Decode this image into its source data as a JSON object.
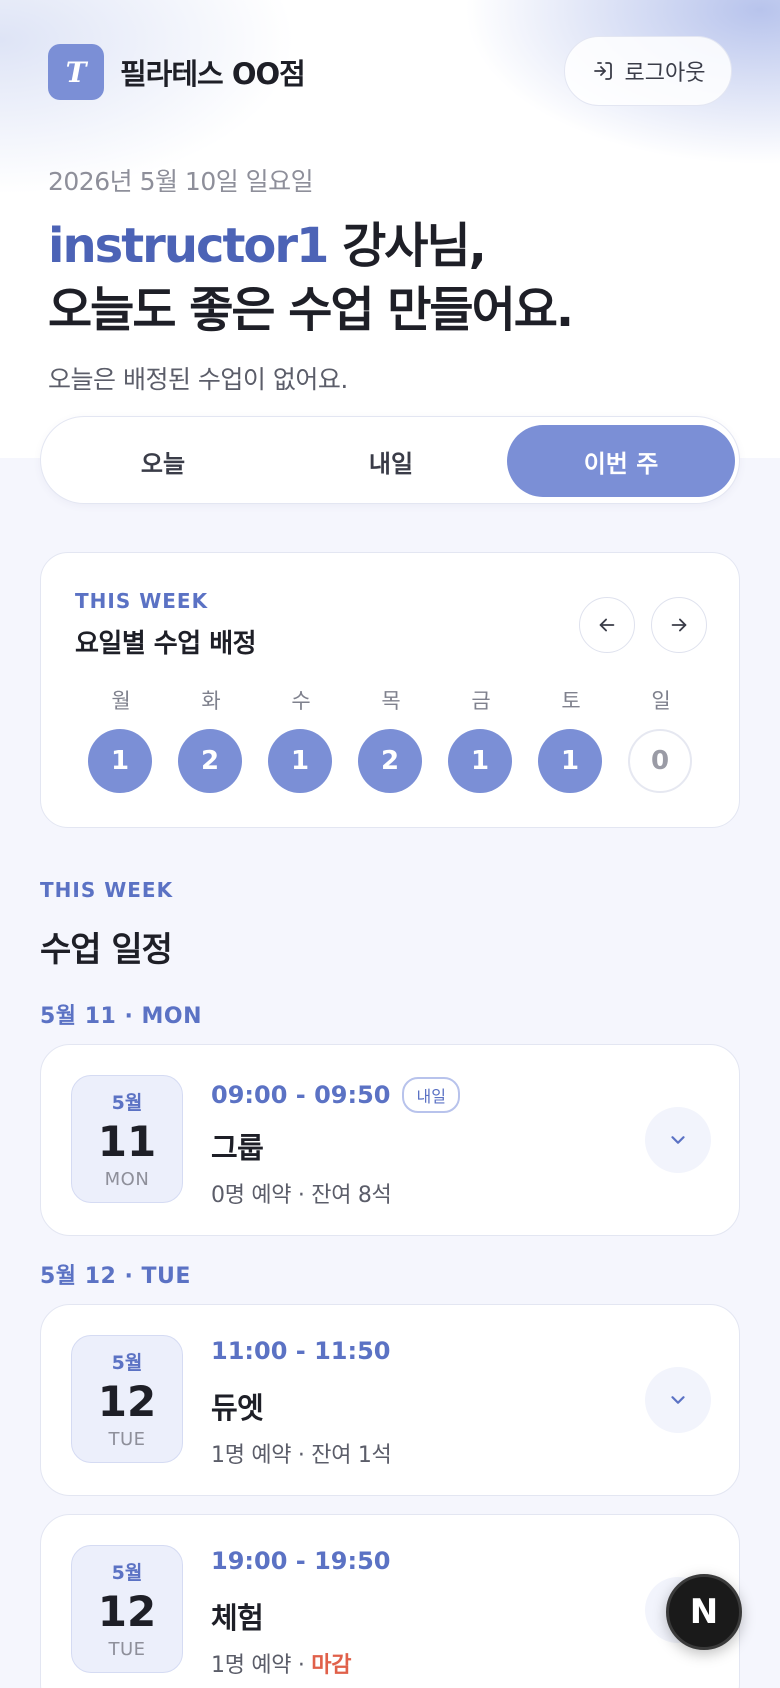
{
  "header": {
    "brand_logo_letter": "T",
    "brand_name": "필라테스 OO점",
    "logout_label": "로그아웃"
  },
  "greeting": {
    "date": "2026년 5월 10일 일요일",
    "name": "instructor1",
    "line1_suffix": " 강사님,",
    "line2": "오늘도 좋은 수업 만들어요.",
    "sub": "오늘은 배정된 수업이 없어요."
  },
  "tabs": [
    {
      "label": "오늘",
      "active": false
    },
    {
      "label": "내일",
      "active": false
    },
    {
      "label": "이번 주",
      "active": true
    }
  ],
  "week": {
    "eyebrow": "THIS WEEK",
    "title": "요일별 수업 배정",
    "days": [
      {
        "label": "월",
        "count": "1"
      },
      {
        "label": "화",
        "count": "2"
      },
      {
        "label": "수",
        "count": "1"
      },
      {
        "label": "목",
        "count": "2"
      },
      {
        "label": "금",
        "count": "1"
      },
      {
        "label": "토",
        "count": "1"
      },
      {
        "label": "일",
        "count": "0"
      }
    ]
  },
  "schedule": {
    "eyebrow": "THIS WEEK",
    "title": "수업 일정",
    "groups": [
      {
        "label": "5월 11 · MON",
        "classes": [
          {
            "month": "5월",
            "day": "11",
            "weekday": "MON",
            "time": "09:00 - 09:50",
            "tag": "내일",
            "name": "그룹",
            "meta_a": "0명 예약 · 잔여 8석",
            "meta_closed": ""
          }
        ]
      },
      {
        "label": "5월 12 · TUE",
        "classes": [
          {
            "month": "5월",
            "day": "12",
            "weekday": "TUE",
            "time": "11:00 - 11:50",
            "tag": "",
            "name": "듀엣",
            "meta_a": "1명 예약 · 잔여 1석",
            "meta_closed": ""
          },
          {
            "month": "5월",
            "day": "12",
            "weekday": "TUE",
            "time": "19:00 - 19:50",
            "tag": "",
            "name": "체험",
            "meta_a": "1명 예약 · ",
            "meta_closed": "마감"
          }
        ]
      }
    ]
  },
  "fab_label": "N",
  "colors": {
    "accent": "#7b8fd6",
    "accent_text": "#5b72c4",
    "closed": "#e0604a"
  }
}
